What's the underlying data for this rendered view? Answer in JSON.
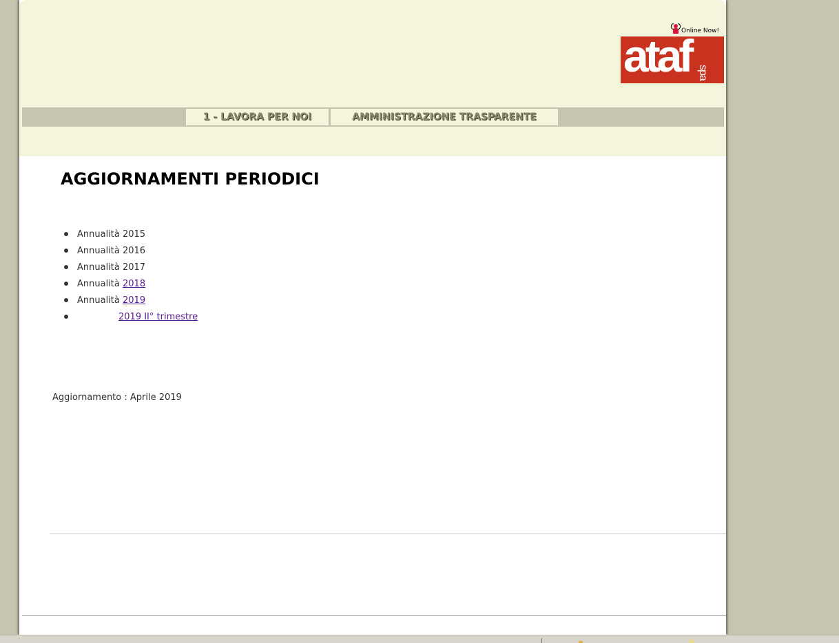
{
  "header": {
    "online_status": "Online Now!",
    "logo": {
      "text": "ataf",
      "suffix": "spa",
      "color": "#c8321e"
    }
  },
  "nav": {
    "tabs": [
      {
        "label": "1 - LAVORA PER NOI"
      },
      {
        "label": "AMMINISTRAZIONE TRASPARENTE"
      }
    ]
  },
  "main": {
    "title": "AGGIORNAMENTI PERIODICI",
    "items": [
      {
        "text": "Annualità 2015",
        "link": ""
      },
      {
        "text": "Annualità 2016",
        "link": ""
      },
      {
        "text": "Annualità 2017",
        "link": ""
      },
      {
        "text": "Annualità ",
        "link": "2018"
      },
      {
        "text": "Annualità ",
        "link": "2019"
      },
      {
        "text": "",
        "link": "2019 II° trimestre"
      }
    ],
    "update_note": "Aggiornamento : Aprile 2019"
  },
  "colors": {
    "page_background": "#c5c5b0",
    "header_background": "#f5f5dc",
    "link": "#551a8b"
  }
}
